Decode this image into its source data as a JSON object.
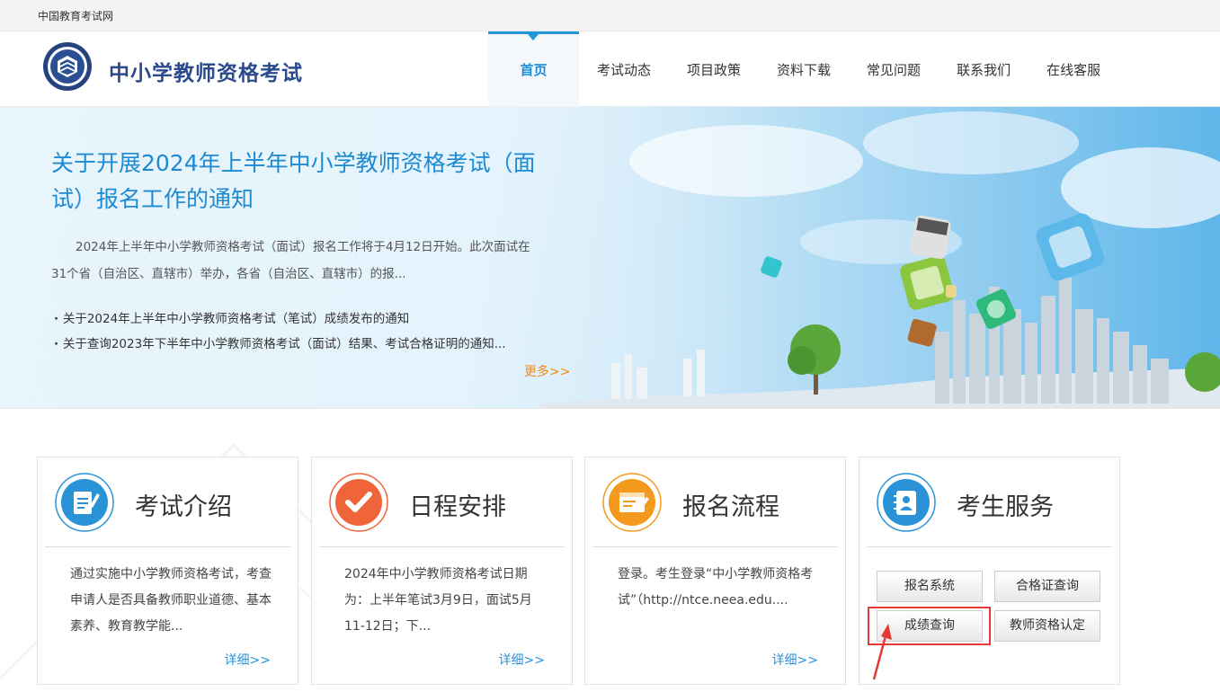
{
  "topbar": {
    "link": "中国教育考试网"
  },
  "header": {
    "logo_text": "中小学教师资格考试",
    "logo_icon": "exam-emblem-icon",
    "nav": [
      "首页",
      "考试动态",
      "项目政策",
      "资料下载",
      "常见问题",
      "联系我们",
      "在线客服"
    ],
    "active_nav": "首页"
  },
  "banner": {
    "title": "关于开展2024年上半年中小学教师资格考试（面试）报名工作的通知",
    "summary": "2024年上半年中小学教师资格考试（面试）报名工作将于4月12日开始。此次面试在31个省（自治区、直辖市）举办，各省（自治区、直辖市）的报...",
    "news": [
      "关于2024年上半年中小学教师资格考试（笔试）成绩发布的通知",
      "关于查询2023年下半年中小学教师资格考试（面试）结果、考试合格证明的通知..."
    ],
    "more": "更多>>"
  },
  "cards": [
    {
      "title": "考试介绍",
      "icon": "document-edit-icon",
      "body": "通过实施中小学教师资格考试，考查申请人是否具备教师职业道德、基本素养、教育教学能...",
      "more": "详细>>",
      "accent": "#2a93d8"
    },
    {
      "title": "日程安排",
      "icon": "checkmark-icon",
      "body": "2024年中小学教师资格考试日期为：上半年笔试3月9日，面试5月11-12日；下...",
      "more": "详细>>",
      "accent": "#f0643a"
    },
    {
      "title": "报名流程",
      "icon": "registration-form-icon",
      "body": "登录。考生登录“中小学教师资格考试”（http://ntce.neea.edu....",
      "more": "详细>>",
      "accent": "#f39a1e"
    },
    {
      "title": "考生服务",
      "icon": "contact-book-icon",
      "accent": "#2a93d8",
      "buttons": [
        "报名系统",
        "合格证查询",
        "成绩查询",
        "教师资格认定"
      ]
    }
  ],
  "colors": {
    "brand_blue": "#1d8ad1",
    "more_orange": "#f08a17",
    "highlight_red": "#e53935"
  }
}
